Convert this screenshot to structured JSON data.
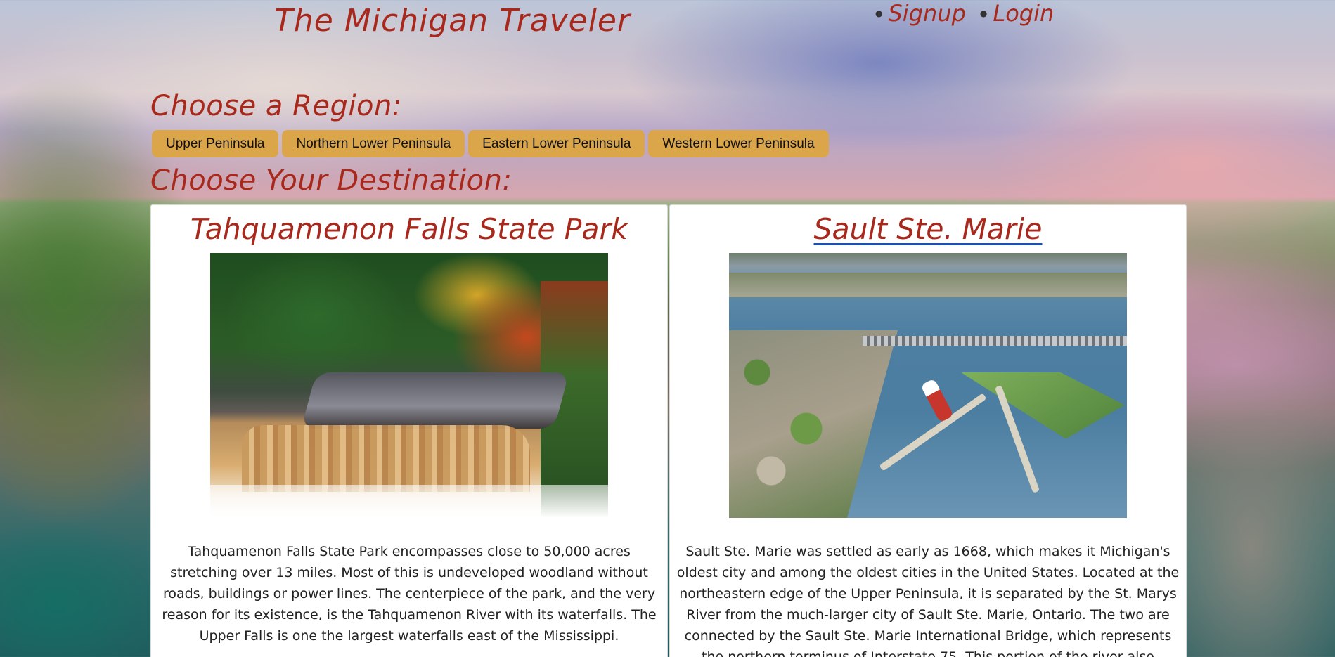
{
  "site": {
    "title": "The Michigan Traveler",
    "accent_color": "#a8281c",
    "button_color": "#dba54a"
  },
  "top_nav": [
    {
      "label": "Signup"
    },
    {
      "label": "Login"
    }
  ],
  "region_heading": "Choose a Region:",
  "regions": [
    {
      "label": "Upper Peninsula"
    },
    {
      "label": "Northern Lower Peninsula"
    },
    {
      "label": "Eastern Lower Peninsula"
    },
    {
      "label": "Western Lower Peninsula"
    }
  ],
  "destination_heading": "Choose Your Destination:",
  "destinations": [
    {
      "title": "Tahquamenon Falls State Park",
      "image": "waterfall photo",
      "description": "Tahquamenon Falls State Park encompasses close to 50,000 acres stretching over 13 miles. Most of this is undeveloped woodland without roads, buildings or power lines. The centerpiece of the park, and the very reason for its existence, is the Tahquamenon River with its waterfalls. The Upper Falls is one the largest waterfalls east of the Mississippi."
    },
    {
      "title": "Sault Ste. Marie",
      "image": "aerial photo of locks",
      "description": "Sault Ste. Marie was settled as early as 1668, which makes it Michigan's oldest city and among the oldest cities in the United States. Located at the northeastern edge of the Upper Peninsula, it is separated by the St. Marys River from the much-larger city of Sault Ste. Marie, Ontario. The two are connected by the Sault Ste. Marie International Bridge, which represents the northern terminus of Interstate 75. This portion of the river also contains the"
    }
  ]
}
